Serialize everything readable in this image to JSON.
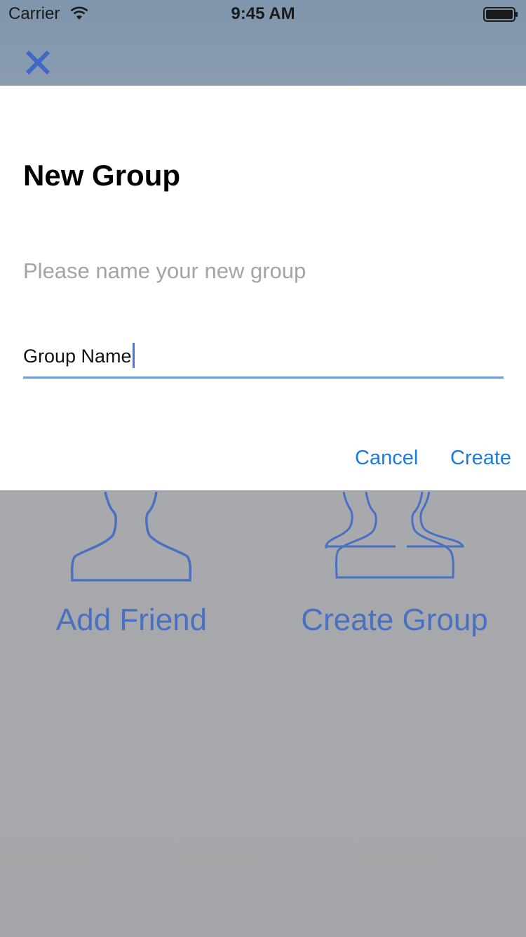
{
  "status_bar": {
    "carrier": "Carrier",
    "time": "9:45 AM",
    "wifi_icon": "wifi-icon",
    "battery_icon": "battery-full-icon"
  },
  "nav": {
    "close_icon": "close-icon"
  },
  "background": {
    "tiles": [
      {
        "label": "Add Friend",
        "icon": "person-silhouette-icon"
      },
      {
        "label": "Create Group",
        "icon": "group-silhouette-icon"
      }
    ]
  },
  "dialog": {
    "title": "New Group",
    "message": "Please name your new group",
    "input": {
      "value": "Group Name",
      "placeholder": ""
    },
    "cancel_label": "Cancel",
    "create_label": "Create"
  },
  "colors": {
    "accent": "#1b7ce0",
    "input_underline": "#6f97e8",
    "background_label": "#4a70c2",
    "nav_icon": "#3f69c2"
  }
}
